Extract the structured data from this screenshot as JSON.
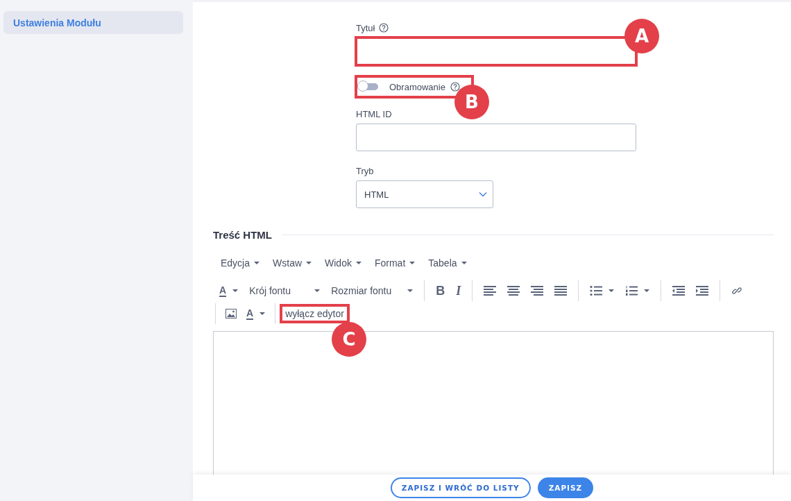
{
  "sidebar": {
    "items": [
      {
        "label": "Ustawienia Modułu",
        "selected": true
      }
    ]
  },
  "fields": [
    {
      "kind": "text",
      "label": "Tytuł",
      "help": true,
      "annotation": "A"
    },
    {
      "kind": "toggle",
      "label": "Obramowanie",
      "on": false,
      "help": true,
      "annotation": "B"
    },
    {
      "kind": "text",
      "label": "HTML ID",
      "help": false
    },
    {
      "kind": "select",
      "label": "Tryb",
      "value": "HTML",
      "help": false
    }
  ],
  "section_title": "Treść HTML",
  "editor": {
    "menus": [
      "Edycja",
      "Wstaw",
      "Widok",
      "Format",
      "Tabela"
    ],
    "text_color_letter": "A",
    "font_family": "Krój fontu",
    "font_size": "Rozmiar fontu",
    "bold": "B",
    "italic": "I",
    "bg_color_letter": "A",
    "toggle_button": "wyłącz edytor",
    "toggle_annotation": "C"
  },
  "buttons": [
    {
      "label": "ZAPISZ I WRÓĆ DO LISTY",
      "kind": "outline"
    },
    {
      "label": "ZAPISZ",
      "kind": "primary"
    }
  ]
}
